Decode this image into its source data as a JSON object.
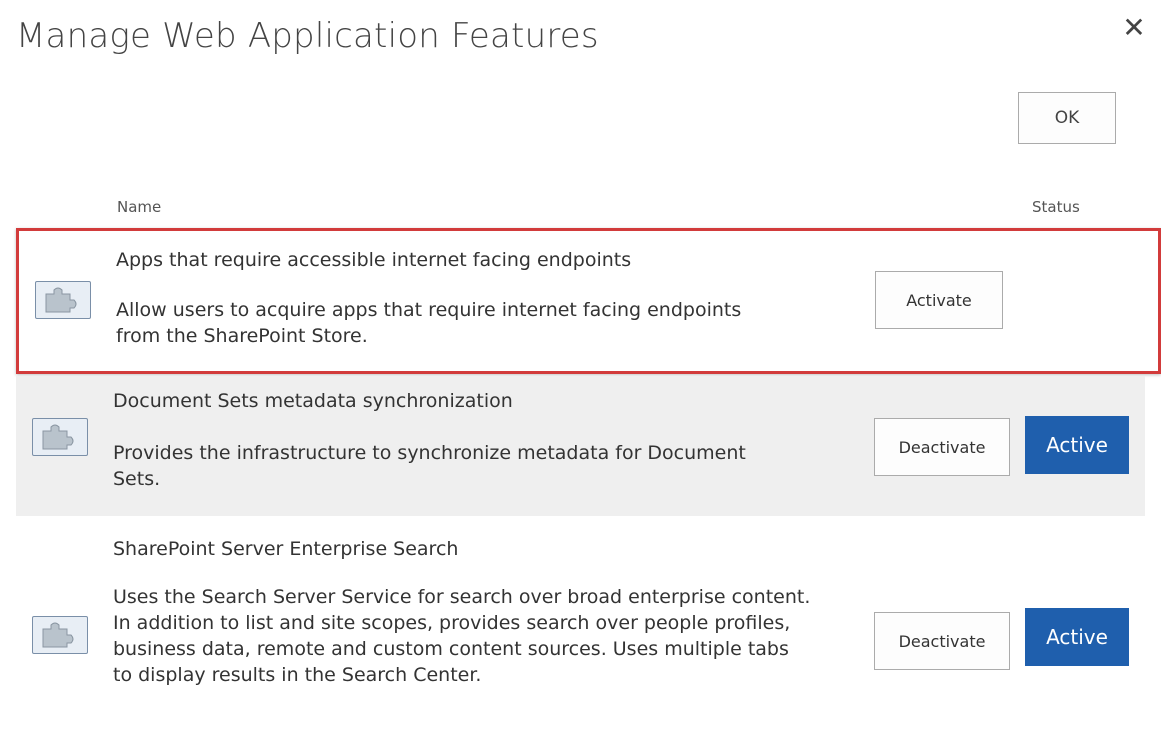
{
  "dialog": {
    "title": "Manage Web Application Features",
    "ok_label": "OK"
  },
  "columns": {
    "name": "Name",
    "status": "Status"
  },
  "features": [
    {
      "name": "Apps that require accessible internet facing endpoints",
      "description": "Allow users to acquire apps that require internet facing endpoints from the SharePoint Store.",
      "button_label": "Activate",
      "status": ""
    },
    {
      "name": "Document Sets metadata synchronization",
      "description": "Provides the infrastructure to synchronize metadata for Document Sets.",
      "button_label": "Deactivate",
      "status": "Active"
    },
    {
      "name": "SharePoint Server Enterprise Search",
      "description": "Uses the Search Server Service for search over broad enterprise content. In addition to list and site scopes, provides search over people profiles, business data, remote and custom content sources. Uses multiple tabs to display results in the Search Center.",
      "button_label": "Deactivate",
      "status": "Active"
    }
  ],
  "icons": {
    "close": "close-icon",
    "feature": "feature-puzzle-icon"
  },
  "colors": {
    "active_badge": "#1f5fad",
    "highlight_border": "#d23b3b",
    "shaded_row": "#efefef"
  }
}
